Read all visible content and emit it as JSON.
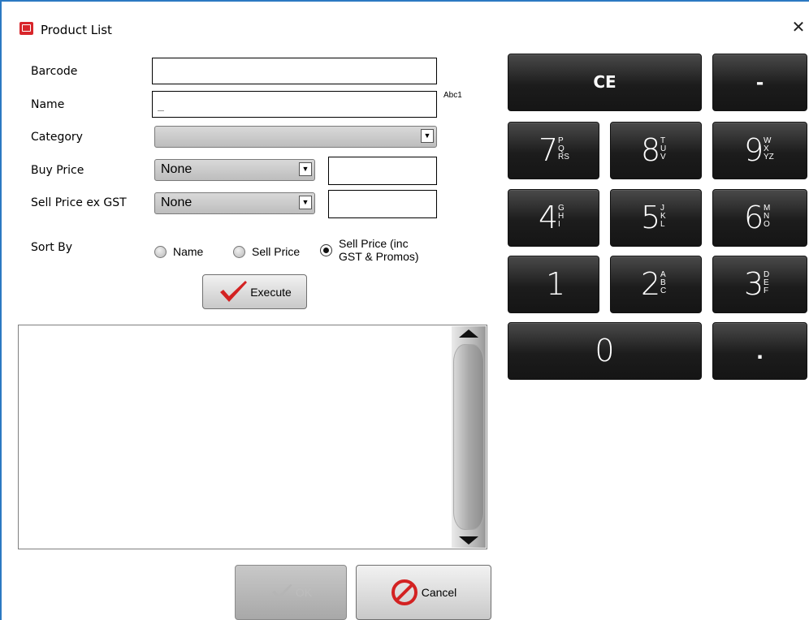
{
  "window": {
    "title": "Product List",
    "close_symbol": "✕"
  },
  "form": {
    "barcode_label": "Barcode",
    "barcode_value": "",
    "name_label": "Name",
    "name_value": "",
    "name_placeholder": "_",
    "keyboard_hint": "Abc1",
    "category_label": "Category",
    "category_value": "",
    "buy_price_label": "Buy Price",
    "buy_price_mode": "None",
    "buy_price_value": "",
    "sell_price_label": "Sell Price ex GST",
    "sell_price_mode": "None",
    "sell_price_value": ""
  },
  "sort": {
    "label": "Sort By",
    "options": [
      "Name",
      "Sell Price",
      "Sell Price (inc\nGST & Promos)"
    ],
    "selected": "Sell Price (inc GST & Promos)"
  },
  "buttons": {
    "execute": "Execute",
    "ok": "OK",
    "cancel": "Cancel"
  },
  "keypad": {
    "ce": "CE",
    "minus": "-",
    "dot": ".",
    "zero": "0",
    "keys": [
      {
        "digit": "7",
        "letters": "P\nQ\nRS"
      },
      {
        "digit": "8",
        "letters": "T\nU\nV"
      },
      {
        "digit": "9",
        "letters": "W\nX\nYZ"
      },
      {
        "digit": "4",
        "letters": "G\nH\nI"
      },
      {
        "digit": "5",
        "letters": "J\nK\nL"
      },
      {
        "digit": "6",
        "letters": "M\nN\nO"
      },
      {
        "digit": "1",
        "letters": ""
      },
      {
        "digit": "2",
        "letters": "A\nB\nC"
      },
      {
        "digit": "3",
        "letters": "D\nE\nF"
      }
    ]
  },
  "colors": {
    "accent_border": "#2b79c2",
    "check_red": "#d32222",
    "key_bg": "#1f1f1f"
  }
}
